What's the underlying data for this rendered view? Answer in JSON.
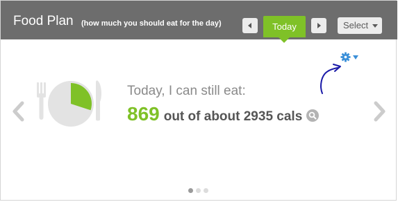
{
  "header": {
    "title": "Food Plan",
    "subtitle": "(how much you should eat for the day)",
    "today_label": "Today",
    "select_label": "Select"
  },
  "main": {
    "prompt": "Today, I can still eat:",
    "calories_remaining": "869",
    "calories_text": "out of about 2935 cals",
    "consumed_fraction": 0.3
  },
  "carousel": {
    "page_count": 3,
    "active_index": 0
  },
  "colors": {
    "header_bg": "#6d6d6d",
    "accent_green": "#7fc127",
    "link_blue": "#3a8fd8",
    "annotation_blue": "#1a1aa8"
  },
  "icons": [
    "chevron-left-icon",
    "chevron-right-icon",
    "gear-icon",
    "caret-down-icon",
    "search-icon",
    "fork-icon",
    "knife-icon",
    "plate-pie-icon"
  ]
}
